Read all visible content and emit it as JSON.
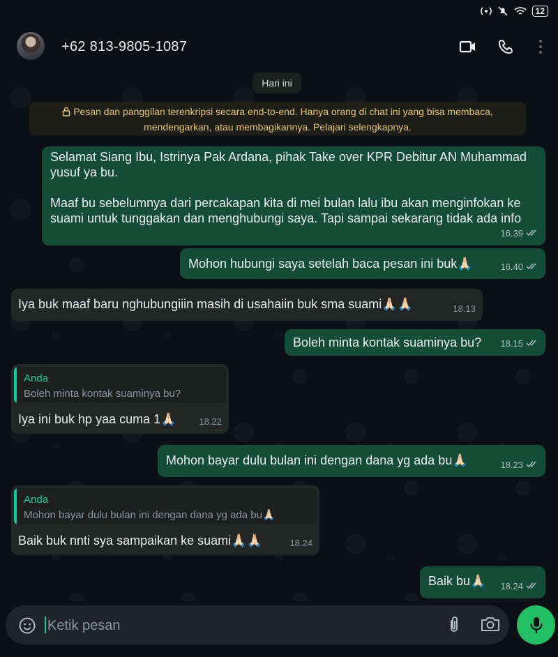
{
  "status": {
    "battery": "12"
  },
  "header": {
    "contact": "+62 813-9805-1087"
  },
  "date_chip": "Hari ini",
  "encryption_notice": "Pesan dan panggilan terenkripsi secara end-to-end. Hanya orang di chat ini yang bisa membaca, mendengarkan, atau membagikannya. Pelajari selengkapnya.",
  "encryption_line1": "Pesan dan panggilan terenkripsi secara end-to-end. Hanya orang di chat ini yang bisa membaca,",
  "encryption_line2": "mendengarkan, atau membagikannya. Pelajari selengkapnya.",
  "messages": [
    {
      "dir": "out",
      "text": "Selamat Siang Ibu, Istrinya Pak Ardana, pihak Take over KPR Debitur AN Muhammad yusuf ya bu.\n\nMaaf bu sebelumnya dari percakapan kita di mei bulan lalu ibu akan menginfokan ke suami untuk tunggakan dan menghubungi saya. Tapi sampai sekarang tidak ada info",
      "time": "16.39"
    },
    {
      "dir": "out",
      "text": "Mohon hubungi saya setelah baca pesan ini buk🙏🏻",
      "time": "16.40"
    },
    {
      "dir": "in",
      "text": "Iya buk maaf baru nghubungiiin masih di usahaiin buk sma suami🙏🏻🙏🏻",
      "time": "18.13"
    },
    {
      "dir": "out",
      "text": "Boleh minta kontak suaminya bu?",
      "time": "18.15"
    },
    {
      "dir": "in",
      "quote_author": "Anda",
      "quote_text": "Boleh minta kontak suaminya bu?",
      "text": "Iya ini buk hp yaa cuma 1🙏🏻",
      "time": "18.22"
    },
    {
      "dir": "out",
      "text": "Mohon bayar dulu bulan ini dengan dana yg ada bu🙏🏻",
      "time": "18.23"
    },
    {
      "dir": "in",
      "quote_author": "Anda",
      "quote_text": "Mohon bayar dulu bulan ini dengan dana yg ada bu🙏🏻",
      "text": "Baik buk nnti sya sampaikan ke suami🙏🏻🙏🏻",
      "time": "18.24"
    },
    {
      "dir": "out",
      "text": "Baik bu🙏🏻",
      "time": "18.24"
    }
  ],
  "input": {
    "placeholder": "Ketik pesan"
  },
  "colors": {
    "outgoing": "#144d37",
    "incoming": "#242626",
    "accent": "#21c063",
    "notice": "#e8c66a"
  }
}
